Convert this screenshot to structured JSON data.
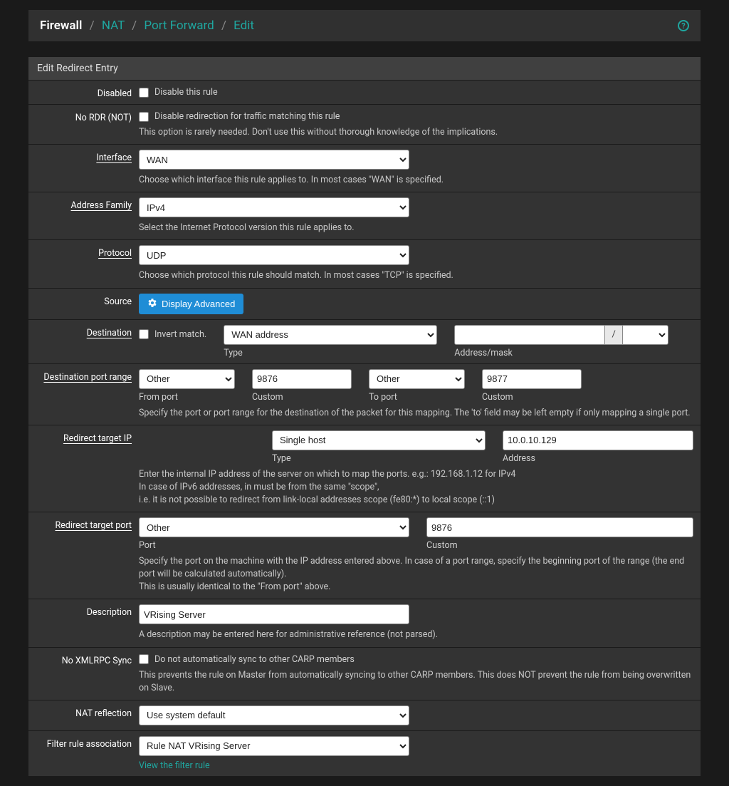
{
  "breadcrumb": {
    "root": "Firewall",
    "nat": "NAT",
    "portforward": "Port Forward",
    "edit": "Edit"
  },
  "panel_title": "Edit Redirect Entry",
  "disabled": {
    "label": "Disabled",
    "chk": "Disable this rule"
  },
  "nordr": {
    "label": "No RDR (NOT)",
    "chk": "Disable redirection for traffic matching this rule",
    "help": "This option is rarely needed. Don't use this without thorough knowledge of the implications."
  },
  "interface": {
    "label": "Interface",
    "value": "WAN",
    "help": "Choose which interface this rule applies to. In most cases \"WAN\" is specified."
  },
  "addrfam": {
    "label": "Address Family",
    "value": "IPv4",
    "help": "Select the Internet Protocol version this rule applies to."
  },
  "protocol": {
    "label": "Protocol",
    "value": "UDP",
    "help": "Choose which protocol this rule should match. In most cases \"TCP\" is specified."
  },
  "source": {
    "label": "Source",
    "btn": "Display Advanced"
  },
  "destination": {
    "label": "Destination",
    "invert": "Invert match.",
    "type_value": "WAN address",
    "type_lbl": "Type",
    "mask_value": "",
    "mask_sel": "",
    "mask_lbl": "Address/mask"
  },
  "destport": {
    "label": "Destination port range",
    "from_sel": "Other",
    "from_lbl": "From port",
    "from_custom": "9876",
    "from_custom_lbl": "Custom",
    "to_sel": "Other",
    "to_lbl": "To port",
    "to_custom": "9877",
    "to_custom_lbl": "Custom",
    "help": "Specify the port or port range for the destination of the packet for this mapping. The 'to' field may be left empty if only mapping a single port."
  },
  "redirip": {
    "label": "Redirect target IP",
    "type_value": "Single host",
    "type_lbl": "Type",
    "addr_value": "10.0.10.129",
    "addr_lbl": "Address",
    "help1": "Enter the internal IP address of the server on which to map the ports. e.g.: 192.168.1.12 for IPv4",
    "help2": "In case of IPv6 addresses, in must be from the same \"scope\",",
    "help3": "i.e. it is not possible to redirect from link-local addresses scope (fe80:*) to local scope (::1)"
  },
  "redirport": {
    "label": "Redirect target port",
    "port_sel": "Other",
    "port_lbl": "Port",
    "custom_val": "9876",
    "custom_lbl": "Custom",
    "help": "Specify the port on the machine with the IP address entered above. In case of a port range, specify the beginning port of the range (the end port will be calculated automatically).",
    "help2": "This is usually identical to the \"From port\" above."
  },
  "description": {
    "label": "Description",
    "value": "VRising Server",
    "help": "A description may be entered here for administrative reference (not parsed)."
  },
  "noxmlrpc": {
    "label": "No XMLRPC Sync",
    "chk": "Do not automatically sync to other CARP members",
    "help": "This prevents the rule on Master from automatically syncing to other CARP members. This does NOT prevent the rule from being overwritten on Slave."
  },
  "natrefl": {
    "label": "NAT reflection",
    "value": "Use system default"
  },
  "filterassoc": {
    "label": "Filter rule association",
    "value": "Rule NAT VRising Server",
    "link": "View the filter rule"
  }
}
